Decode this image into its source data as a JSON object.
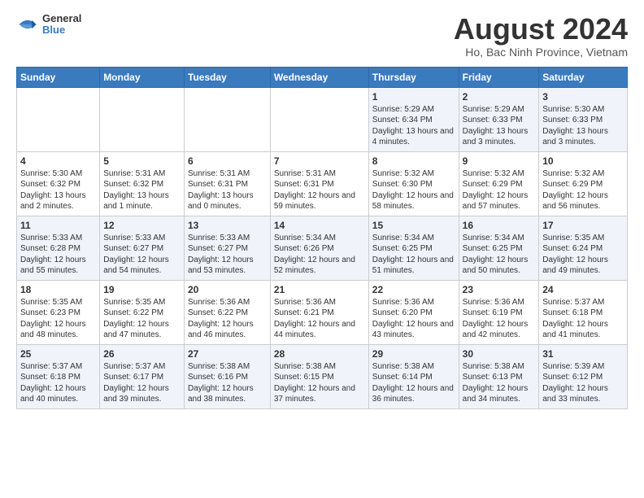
{
  "logo": {
    "general": "General",
    "blue": "Blue"
  },
  "title": "August 2024",
  "subtitle": "Ho, Bac Ninh Province, Vietnam",
  "days_of_week": [
    "Sunday",
    "Monday",
    "Tuesday",
    "Wednesday",
    "Thursday",
    "Friday",
    "Saturday"
  ],
  "weeks": [
    [
      {
        "day": "",
        "content": ""
      },
      {
        "day": "",
        "content": ""
      },
      {
        "day": "",
        "content": ""
      },
      {
        "day": "",
        "content": ""
      },
      {
        "day": "1",
        "content": "Sunrise: 5:29 AM\nSunset: 6:34 PM\nDaylight: 13 hours\nand 4 minutes."
      },
      {
        "day": "2",
        "content": "Sunrise: 5:29 AM\nSunset: 6:33 PM\nDaylight: 13 hours\nand 3 minutes."
      },
      {
        "day": "3",
        "content": "Sunrise: 5:30 AM\nSunset: 6:33 PM\nDaylight: 13 hours\nand 3 minutes."
      }
    ],
    [
      {
        "day": "4",
        "content": "Sunrise: 5:30 AM\nSunset: 6:32 PM\nDaylight: 13 hours\nand 2 minutes."
      },
      {
        "day": "5",
        "content": "Sunrise: 5:31 AM\nSunset: 6:32 PM\nDaylight: 13 hours\nand 1 minute."
      },
      {
        "day": "6",
        "content": "Sunrise: 5:31 AM\nSunset: 6:31 PM\nDaylight: 13 hours\nand 0 minutes."
      },
      {
        "day": "7",
        "content": "Sunrise: 5:31 AM\nSunset: 6:31 PM\nDaylight: 12 hours\nand 59 minutes."
      },
      {
        "day": "8",
        "content": "Sunrise: 5:32 AM\nSunset: 6:30 PM\nDaylight: 12 hours\nand 58 minutes."
      },
      {
        "day": "9",
        "content": "Sunrise: 5:32 AM\nSunset: 6:29 PM\nDaylight: 12 hours\nand 57 minutes."
      },
      {
        "day": "10",
        "content": "Sunrise: 5:32 AM\nSunset: 6:29 PM\nDaylight: 12 hours\nand 56 minutes."
      }
    ],
    [
      {
        "day": "11",
        "content": "Sunrise: 5:33 AM\nSunset: 6:28 PM\nDaylight: 12 hours\nand 55 minutes."
      },
      {
        "day": "12",
        "content": "Sunrise: 5:33 AM\nSunset: 6:27 PM\nDaylight: 12 hours\nand 54 minutes."
      },
      {
        "day": "13",
        "content": "Sunrise: 5:33 AM\nSunset: 6:27 PM\nDaylight: 12 hours\nand 53 minutes."
      },
      {
        "day": "14",
        "content": "Sunrise: 5:34 AM\nSunset: 6:26 PM\nDaylight: 12 hours\nand 52 minutes."
      },
      {
        "day": "15",
        "content": "Sunrise: 5:34 AM\nSunset: 6:25 PM\nDaylight: 12 hours\nand 51 minutes."
      },
      {
        "day": "16",
        "content": "Sunrise: 5:34 AM\nSunset: 6:25 PM\nDaylight: 12 hours\nand 50 minutes."
      },
      {
        "day": "17",
        "content": "Sunrise: 5:35 AM\nSunset: 6:24 PM\nDaylight: 12 hours\nand 49 minutes."
      }
    ],
    [
      {
        "day": "18",
        "content": "Sunrise: 5:35 AM\nSunset: 6:23 PM\nDaylight: 12 hours\nand 48 minutes."
      },
      {
        "day": "19",
        "content": "Sunrise: 5:35 AM\nSunset: 6:22 PM\nDaylight: 12 hours\nand 47 minutes."
      },
      {
        "day": "20",
        "content": "Sunrise: 5:36 AM\nSunset: 6:22 PM\nDaylight: 12 hours\nand 46 minutes."
      },
      {
        "day": "21",
        "content": "Sunrise: 5:36 AM\nSunset: 6:21 PM\nDaylight: 12 hours\nand 44 minutes."
      },
      {
        "day": "22",
        "content": "Sunrise: 5:36 AM\nSunset: 6:20 PM\nDaylight: 12 hours\nand 43 minutes."
      },
      {
        "day": "23",
        "content": "Sunrise: 5:36 AM\nSunset: 6:19 PM\nDaylight: 12 hours\nand 42 minutes."
      },
      {
        "day": "24",
        "content": "Sunrise: 5:37 AM\nSunset: 6:18 PM\nDaylight: 12 hours\nand 41 minutes."
      }
    ],
    [
      {
        "day": "25",
        "content": "Sunrise: 5:37 AM\nSunset: 6:18 PM\nDaylight: 12 hours\nand 40 minutes."
      },
      {
        "day": "26",
        "content": "Sunrise: 5:37 AM\nSunset: 6:17 PM\nDaylight: 12 hours\nand 39 minutes."
      },
      {
        "day": "27",
        "content": "Sunrise: 5:38 AM\nSunset: 6:16 PM\nDaylight: 12 hours\nand 38 minutes."
      },
      {
        "day": "28",
        "content": "Sunrise: 5:38 AM\nSunset: 6:15 PM\nDaylight: 12 hours\nand 37 minutes."
      },
      {
        "day": "29",
        "content": "Sunrise: 5:38 AM\nSunset: 6:14 PM\nDaylight: 12 hours\nand 36 minutes."
      },
      {
        "day": "30",
        "content": "Sunrise: 5:38 AM\nSunset: 6:13 PM\nDaylight: 12 hours\nand 34 minutes."
      },
      {
        "day": "31",
        "content": "Sunrise: 5:39 AM\nSunset: 6:12 PM\nDaylight: 12 hours\nand 33 minutes."
      }
    ]
  ]
}
